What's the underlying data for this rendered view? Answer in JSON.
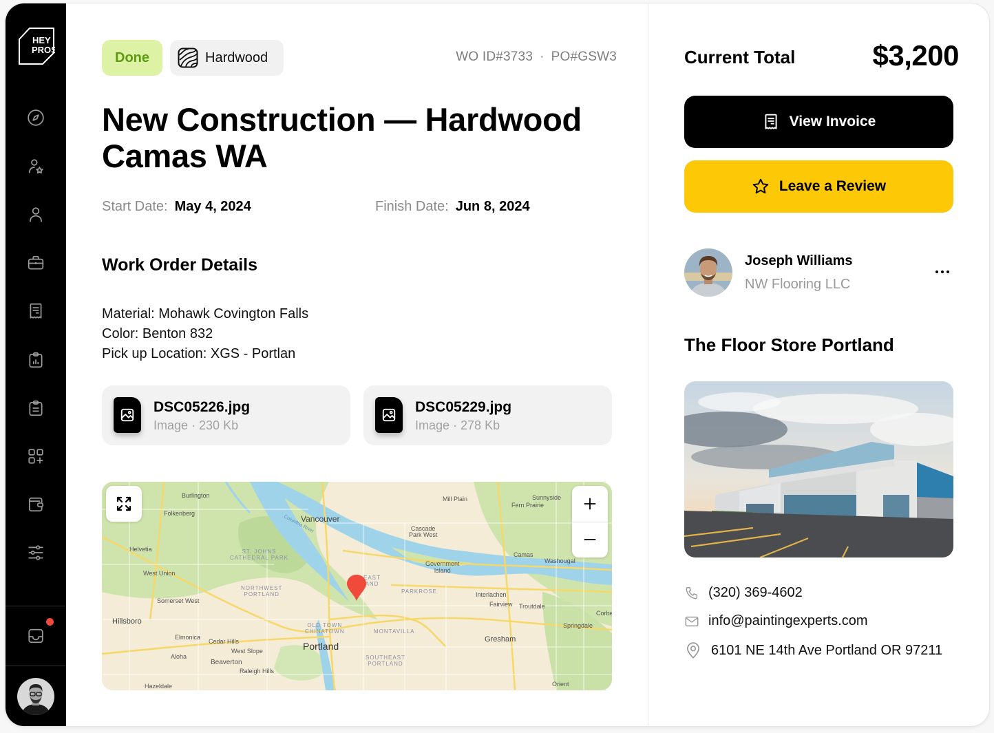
{
  "app": {
    "logo_text_line1": "HEY",
    "logo_text_line2": "PROS"
  },
  "sidebar": {
    "items": [
      {
        "name": "explore",
        "icon": "compass-icon"
      },
      {
        "name": "favorite-pros",
        "icon": "user-star-icon"
      },
      {
        "name": "profile",
        "icon": "user-icon"
      },
      {
        "name": "jobs",
        "icon": "briefcase-icon"
      },
      {
        "name": "invoices",
        "icon": "receipt-icon"
      },
      {
        "name": "reports",
        "icon": "clipboard-chart-icon"
      },
      {
        "name": "work-orders",
        "icon": "clipboard-list-icon"
      },
      {
        "name": "add-apps",
        "icon": "grid-plus-icon"
      },
      {
        "name": "wallet",
        "icon": "wallet-icon"
      },
      {
        "name": "settings",
        "icon": "sliders-icon"
      }
    ],
    "inbox": {
      "icon": "inbox-icon",
      "has_notification": true
    },
    "colors": {
      "background": "#000000",
      "notification": "#f04a3a"
    }
  },
  "work_order": {
    "status": "Done",
    "category": "Hardwood",
    "wo_id": "WO ID#3733",
    "separator": "·",
    "po_id": "PO#GSW3",
    "title_line1": "New Construction — Hardwood",
    "title_line2": "Camas WA",
    "start_label": "Start Date:",
    "start_value": "May 4, 2024",
    "finish_label": "Finish Date:",
    "finish_value": "Jun 8, 2024",
    "details_heading": "Work Order Details",
    "details": [
      "Material: Mohawk Covington Falls",
      "Color: Benton 832",
      "Pick up Location: XGS - Portlan"
    ],
    "attachments": [
      {
        "name": "DSC05226.jpg",
        "type": "Image",
        "size": "230 Kb"
      },
      {
        "name": "DSC05229.jpg",
        "type": "Image",
        "size": "278 Kb"
      }
    ],
    "colors": {
      "done_bg": "#ddf2a5",
      "done_text": "#5d9b13"
    }
  },
  "map": {
    "labels": {
      "vancouver": "Vancouver",
      "portland": "Portland",
      "gresham": "Gresham",
      "hillsboro": "Hillsboro",
      "beaverton": "Beaverton",
      "burlington": "Burlington",
      "folkenberg": "Folkenberg",
      "helvetia": "Helvetia",
      "west_union": "West Union",
      "somerset_west": "Somerset West",
      "elmonica": "Elmonica",
      "cedar_hills": "Cedar Hills",
      "west_slope": "West Slope",
      "aloha": "Aloha",
      "raleigh_hills": "Raleigh Hills",
      "hazeldale": "Hazeldale",
      "mill_plain": "Mill Plain",
      "sunnyside": "Sunnyside",
      "fern_prairie": "Fern Prairie",
      "cascade_park_1": "Cascade",
      "cascade_park_2": "Park West",
      "government_island_1": "Government",
      "government_island_2": "Island",
      "camas": "Camas",
      "washougal": "Washougal",
      "interlachen": "Interlachen",
      "fairview": "Fairview",
      "troutdale": "Troutdale",
      "springdale": "Springdale",
      "corbett": "Corbe",
      "orient": "Orient",
      "columbia_river": "Columbia River",
      "st_johns_1": "ST. JOHNS",
      "st_johns_2": "CATHEDRAL PARK",
      "nw_portland_1": "NORTHWEST",
      "nw_portland_2": "PORTLAND",
      "old_town_1": "OLD TOWN",
      "old_town_2": "CHINATOWN",
      "parkrose": "PARKROSE",
      "montavilla": "MONTAVILLA",
      "se_portland_1": "SOUTHEAST",
      "se_portland_2": "PORTLAND",
      "ne_portland_1": "EAST",
      "ne_portland_2": "AND"
    },
    "controls": {
      "expand": "expand-icon",
      "zoom_in": "+",
      "zoom_out": "−"
    },
    "pin_color": "#f04a3a"
  },
  "summary": {
    "total_label": "Current Total",
    "total_value": "$3,200",
    "view_invoice_label": "View Invoice",
    "review_label": "Leave a Review",
    "colors": {
      "invoice_bg": "#000000",
      "review_bg": "#fdc806"
    }
  },
  "contact": {
    "name": "Joseph Williams",
    "company": "NW Flooring LLC"
  },
  "store": {
    "name": "The Floor Store Portland",
    "phone": "(320) 369-4602",
    "email": "info@paintingexperts.com",
    "address": "6101 NE 14th Ave Portland OR 97211"
  }
}
